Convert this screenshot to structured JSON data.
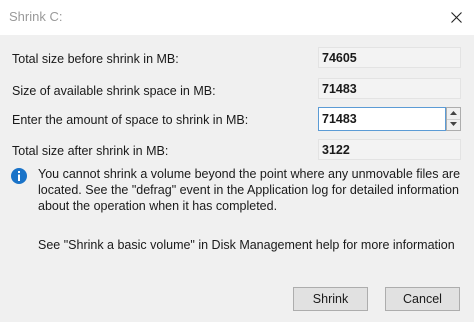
{
  "window": {
    "title": "Shrink C:",
    "close_icon": "close-icon"
  },
  "fields": {
    "total_before": {
      "label": "Total size before shrink in MB:",
      "value": "74605"
    },
    "available": {
      "label": "Size of available shrink space in MB:",
      "value": "71483"
    },
    "amount": {
      "label": "Enter the amount of space to shrink in MB:",
      "value": "71483"
    },
    "total_after": {
      "label": "Total size after shrink in MB:",
      "value": "3122"
    }
  },
  "info": {
    "icon": "info-icon",
    "color": "#1a73c8",
    "text": "You cannot shrink a volume beyond the point where any unmovable files are located. See the \"defrag\" event in the Application log for detailed information about the operation when it has completed."
  },
  "help": {
    "text": "See \"Shrink a basic volume\" in Disk Management help for more information"
  },
  "buttons": {
    "shrink": "Shrink",
    "cancel": "Cancel"
  }
}
